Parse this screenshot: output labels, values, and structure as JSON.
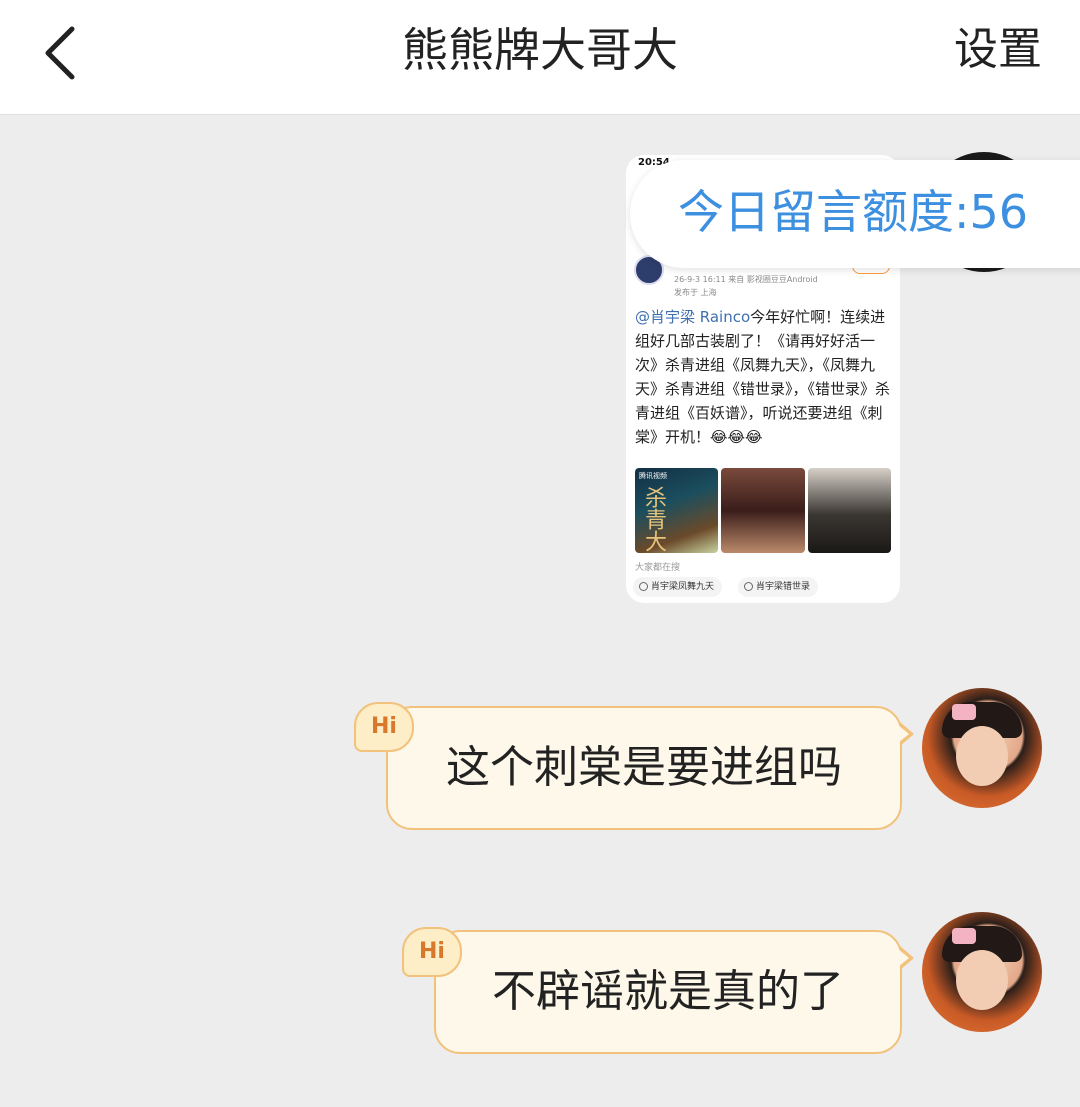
{
  "header": {
    "back_icon": "chevron-left-icon",
    "title": "熊熊牌大哥大",
    "settings_label": "设置"
  },
  "quota": {
    "text": "今日留言额度:56"
  },
  "screenshot": {
    "status_time": "20:54",
    "post_meta_line1": "26-9-3 16:11   来自 影视圈豆豆Android",
    "post_meta_line2": "发布于 上海",
    "mention": "@肖宇梁 Rainco",
    "post_text": "今年好忙啊！连续进组好几部古装剧了！《请再好好活一次》杀青进组《凤舞九天》，《凤舞九天》杀青进组《错世录》，《错世录》杀青进组《百妖谱》，听说还要进组《刺棠》开机！😂😂😂",
    "image_tag": "腾讯视频",
    "image_title_char": "杀青大",
    "search_label": "大家都在搜",
    "search_pills": [
      "肖宇梁凤舞九天",
      "肖宇梁错世录"
    ]
  },
  "messages": [
    {
      "badge": "Hi",
      "text": "这个刺棠是要进组吗"
    },
    {
      "badge": "Hi",
      "text": "不辟谣就是真的了"
    }
  ],
  "colors": {
    "accent_blue": "#3d8fe0",
    "bubble_fill": "#fdf8ea",
    "bubble_border": "#f2c27c",
    "background": "#ededed"
  }
}
